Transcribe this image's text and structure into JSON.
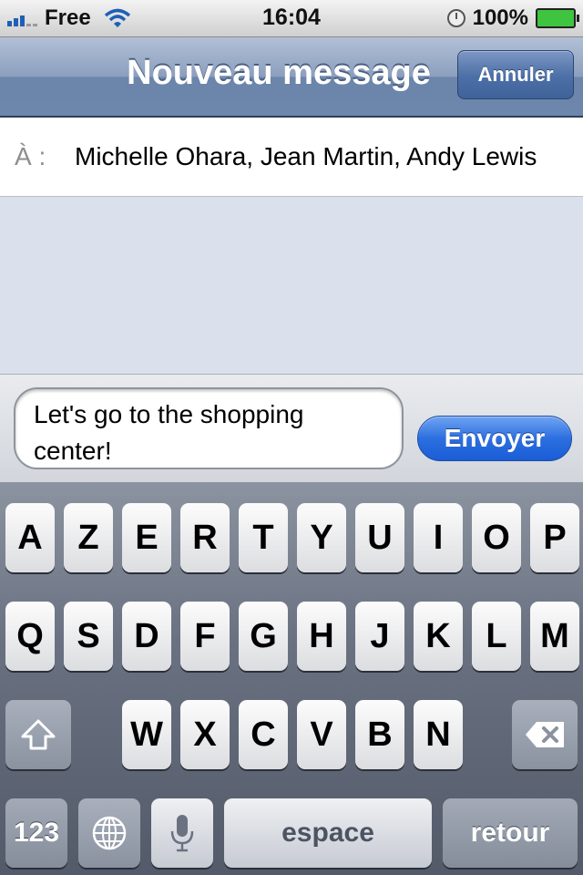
{
  "status_bar": {
    "carrier": "Free",
    "time": "16:04",
    "battery": "100%"
  },
  "nav": {
    "title": "Nouveau message",
    "cancel_label": "Annuler"
  },
  "recipients": {
    "label": "À :",
    "value": "Michelle Ohara, Jean Martin, Andy Lewis"
  },
  "compose": {
    "message_text": "Let's go to the shopping center!",
    "send_label": "Envoyer"
  },
  "keyboard": {
    "row1": [
      "A",
      "Z",
      "E",
      "R",
      "T",
      "Y",
      "U",
      "I",
      "O",
      "P"
    ],
    "row2": [
      "Q",
      "S",
      "D",
      "F",
      "G",
      "H",
      "J",
      "K",
      "L",
      "M"
    ],
    "row3": [
      "W",
      "X",
      "C",
      "V",
      "B",
      "N"
    ],
    "numbers_label": "123",
    "space_label": "espace",
    "return_label": "retour",
    "icons": [
      "shift-icon",
      "backspace-icon",
      "globe-icon",
      "microphone-icon"
    ]
  },
  "colors": {
    "nav_bar": "#6d86ab",
    "send_button": "#2c6fe0",
    "background": "#dbe1ec"
  }
}
